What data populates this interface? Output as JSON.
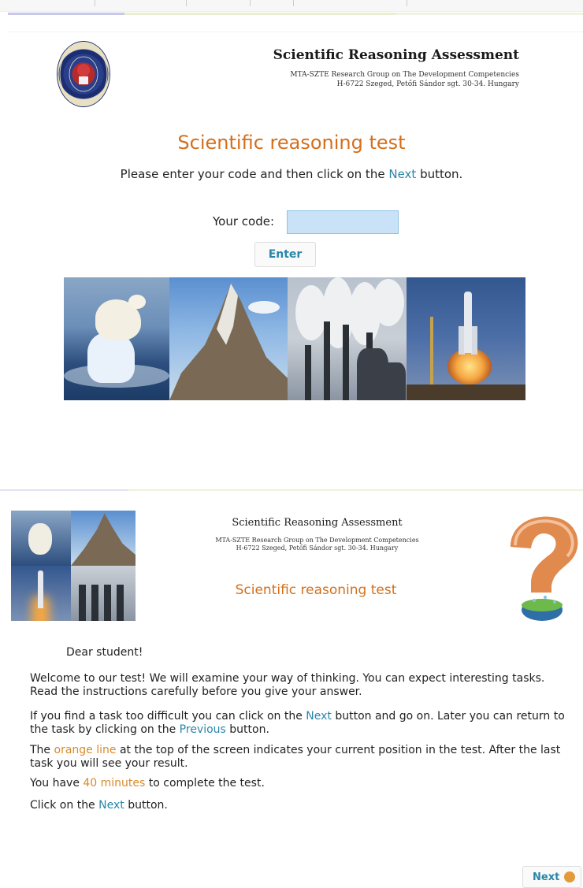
{
  "login": {
    "header": {
      "title": "Scientific Reasoning Assessment",
      "subtitle_line1": "MTA-SZTE Research Group on The Development Competencies",
      "subtitle_line2": "H-6722 Szeged, Petőfi Sándor sgt. 30-34. Hungary"
    },
    "test_title": "Scientific reasoning test",
    "instruction_before": "Please enter your code and then click on the",
    "instruction_link": "Next",
    "instruction_after": "button.",
    "code_label": "Your code:",
    "code_value": "",
    "enter_label": "Enter"
  },
  "welcome": {
    "header": {
      "title": "Scientific Reasoning Assessment",
      "subtitle_line1": "MTA-SZTE Research Group on The Development Competencies",
      "subtitle_line2": "H-6722 Szeged, Petőfi Sándor sgt. 30-34. Hungary"
    },
    "test_title": "Scientific reasoning test",
    "greeting": "Dear student!",
    "p1": "Welcome to our test! We will examine your way of thinking. You can expect interesting tasks. Read the instructions carefully before you give your answer.",
    "p2_before": "If you find a task too difficult you can click on the",
    "p2_link1": "Next",
    "p2_middle": "button and go on. Later you can return to the task by clicking on the",
    "p2_link2": "Previous",
    "p2_after": "button.",
    "p3_before": "The",
    "p3_highlight": "orange line",
    "p3_after": "at the top of the screen indicates your current position in the test. After the last task you will see your result.",
    "p4_before": "You have",
    "p4_highlight": "40 minutes",
    "p4_after": "to complete the test.",
    "p5_before": "Click on the",
    "p5_link": "Next",
    "p5_after": "button.",
    "next_label": "Next"
  },
  "colors": {
    "title_orange": "#d36f1c",
    "link_blue": "#2a86a8",
    "highlight_orange": "#d98a2a",
    "input_fill": "#c9e2f8"
  },
  "icons": {
    "seal": "academy-seal-icon",
    "question": "question-mark-icon",
    "next_arrow": "arrow-right-icon"
  }
}
